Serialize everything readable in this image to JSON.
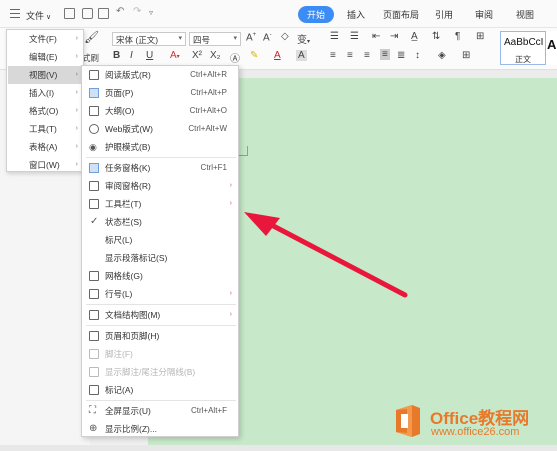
{
  "titlebar": {
    "file_label": "文件",
    "tabs": [
      {
        "label": "开始",
        "active": true
      },
      {
        "label": "插入"
      },
      {
        "label": "页面布局"
      },
      {
        "label": "引用"
      },
      {
        "label": "审阅"
      },
      {
        "label": "视图"
      }
    ]
  },
  "ribbon": {
    "font_name": "宋体 (正文)",
    "font_size": "四号",
    "style_sample": "AaBbCcI",
    "style_name": "正文",
    "style_sample2": "A",
    "partial_label": "式刷",
    "bold": "B",
    "italic": "I",
    "underline": "U"
  },
  "main_menu": {
    "items": [
      {
        "label": "文件(F)"
      },
      {
        "label": "编辑(E)"
      },
      {
        "label": "视图(V)",
        "hover": true
      },
      {
        "label": "插入(I)"
      },
      {
        "label": "格式(O)"
      },
      {
        "label": "工具(T)"
      },
      {
        "label": "表格(A)"
      },
      {
        "label": "窗口(W)"
      }
    ]
  },
  "submenu": {
    "items": [
      {
        "label": "阅读版式(R)",
        "shortcut": "Ctrl+Alt+R",
        "icon": "reading-icon"
      },
      {
        "label": "页面(P)",
        "shortcut": "Ctrl+Alt+P",
        "icon": "page-icon",
        "selected": true
      },
      {
        "label": "大纲(O)",
        "shortcut": "Ctrl+Alt+O",
        "icon": "outline-icon"
      },
      {
        "label": "Web版式(W)",
        "shortcut": "Ctrl+Alt+W",
        "icon": "globe-icon"
      },
      {
        "label": "护眼模式(B)",
        "shortcut": "",
        "icon": "eye-icon"
      },
      {
        "label": "任务窗格(K)",
        "shortcut": "Ctrl+F1",
        "icon": "task-pane-icon",
        "selected": true
      },
      {
        "label": "审阅窗格(R)",
        "shortcut": "",
        "icon": "review-pane-icon",
        "arrow": true
      },
      {
        "label": "工具栏(T)",
        "shortcut": "",
        "icon": "toolbar-icon",
        "arrow": true
      },
      {
        "label": "状态栏(S)",
        "shortcut": "",
        "icon": "check-icon",
        "checked": true
      },
      {
        "label": "标尺(L)",
        "shortcut": "",
        "icon": ""
      },
      {
        "label": "显示段落标记(S)",
        "shortcut": "",
        "icon": ""
      },
      {
        "label": "网格线(G)",
        "shortcut": "",
        "icon": "grid-icon"
      },
      {
        "label": "行号(L)",
        "shortcut": "",
        "icon": "line-number-icon",
        "arrow": true
      },
      {
        "label": "文档结构图(M)",
        "shortcut": "",
        "icon": "doc-structure-icon",
        "arrow": true
      },
      {
        "label": "页眉和页脚(H)",
        "shortcut": "",
        "icon": "header-footer-icon"
      },
      {
        "label": "脚注(F)",
        "shortcut": "",
        "icon": "footnote-icon",
        "disabled": true
      },
      {
        "label": "显示脚注/尾注分隔线(B)",
        "shortcut": "",
        "icon": "footnote-sep-icon",
        "disabled": true
      },
      {
        "label": "标记(A)",
        "shortcut": "",
        "icon": "markup-icon"
      },
      {
        "label": "全屏显示(U)",
        "shortcut": "Ctrl+Alt+F",
        "icon": "fullscreen-icon"
      },
      {
        "label": "显示比例(Z)...",
        "shortcut": "",
        "icon": "zoom-icon"
      }
    ]
  },
  "watermark": {
    "title": "Office教程网",
    "url": "www.office26.com"
  },
  "colors": {
    "accent": "#3b8cf4",
    "page_bg": "#c7e9c9",
    "arrow": "#e8173b",
    "watermark": "#e8792b"
  }
}
